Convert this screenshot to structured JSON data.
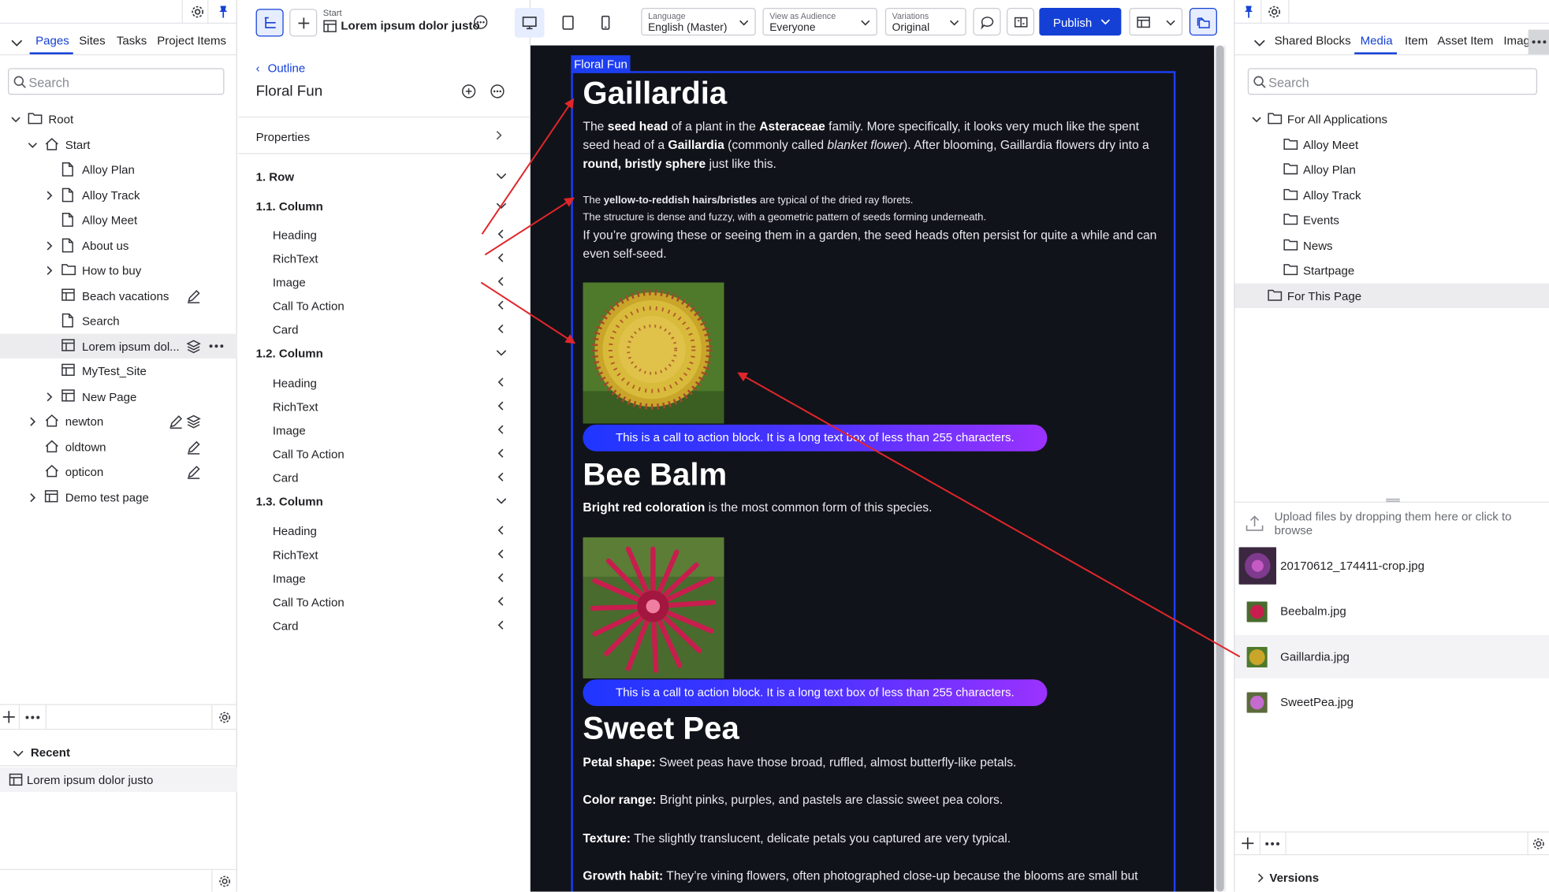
{
  "left_panel": {
    "tabs": [
      "Pages",
      "Sites",
      "Tasks",
      "Project Items"
    ],
    "search_placeholder": "Search",
    "tree": [
      {
        "label": "Root",
        "level": 0,
        "expand": "open",
        "icon": "folder"
      },
      {
        "label": "Start",
        "level": 1,
        "expand": "open",
        "icon": "home"
      },
      {
        "label": "Alloy Plan",
        "level": 2,
        "expand": "none",
        "icon": "page"
      },
      {
        "label": "Alloy Track",
        "level": 2,
        "expand": "closed",
        "icon": "page"
      },
      {
        "label": "Alloy Meet",
        "level": 2,
        "expand": "none",
        "icon": "page"
      },
      {
        "label": "About us",
        "level": 2,
        "expand": "closed",
        "icon": "page"
      },
      {
        "label": "How to buy",
        "level": 2,
        "expand": "closed",
        "icon": "folder"
      },
      {
        "label": "Beach vacations",
        "level": 2,
        "expand": "none",
        "icon": "layout",
        "action": "edit"
      },
      {
        "label": "Search",
        "level": 2,
        "expand": "none",
        "icon": "page"
      },
      {
        "label": "Lorem ipsum dol...",
        "level": 2,
        "expand": "none",
        "icon": "layout",
        "action": "layers-more",
        "selected": true
      },
      {
        "label": "MyTest_Site",
        "level": 2,
        "expand": "none",
        "icon": "layout"
      },
      {
        "label": "New Page",
        "level": 2,
        "expand": "closed",
        "icon": "layout"
      },
      {
        "label": "newton",
        "level": 1,
        "expand": "closed",
        "icon": "home",
        "action": "edit-layers"
      },
      {
        "label": "oldtown",
        "level": 1,
        "expand": "none",
        "icon": "home",
        "action": "edit"
      },
      {
        "label": "opticon",
        "level": 1,
        "expand": "none",
        "icon": "home",
        "action": "edit"
      },
      {
        "label": "Demo test page",
        "level": 1,
        "expand": "closed",
        "icon": "layout"
      }
    ],
    "recent_title": "Recent",
    "recent_item": "Lorem ipsum dolor justo"
  },
  "outline_panel": {
    "breadcrumb_label": "Start",
    "page_name": "Lorem ipsum dolor justo",
    "back_label": "Outline",
    "title": "Floral Fun",
    "properties_label": "Properties",
    "rows": [
      {
        "label": "1. Row",
        "group": true
      },
      {
        "label": "1.1. Column",
        "group": true
      },
      {
        "label": "Heading"
      },
      {
        "label": "RichText"
      },
      {
        "label": "Image"
      },
      {
        "label": "Call To Action"
      },
      {
        "label": "Card"
      },
      {
        "label": "1.2. Column",
        "group": true
      },
      {
        "label": "Heading"
      },
      {
        "label": "RichText"
      },
      {
        "label": "Image"
      },
      {
        "label": "Call To Action"
      },
      {
        "label": "Card"
      },
      {
        "label": "1.3. Column",
        "group": true
      },
      {
        "label": "Heading"
      },
      {
        "label": "RichText"
      },
      {
        "label": "Image"
      },
      {
        "label": "Call To Action"
      },
      {
        "label": "Card"
      }
    ]
  },
  "toolbar": {
    "language": {
      "caption": "Language",
      "value": "English (Master)"
    },
    "audience": {
      "caption": "View as Audience",
      "value": "Everyone"
    },
    "variations": {
      "caption": "Variations",
      "value": "Original"
    },
    "publish_label": "Publish"
  },
  "preview": {
    "frame_label": "Floral Fun",
    "gaillardia": {
      "heading": "Gaillardia",
      "p1_a": "The ",
      "p1_b": "seed head",
      "p1_c": " of a plant in the ",
      "p1_d": "Asteraceae",
      "p1_e": " family. More specifically, it looks very much like the spent seed head of a ",
      "p1_f": "Gaillardia",
      "p1_g": " (commonly called ",
      "p1_h": "blanket flower",
      "p1_i": "). After blooming, Gaillardia flowers dry into a ",
      "p1_j": "round, bristly sphere",
      "p1_k": " just like this.",
      "s1_a": "The ",
      "s1_b": "yellow-to-reddish hairs/bristles",
      "s1_c": " are typical of the dried ray florets.",
      "s2": "The structure is dense and fuzzy, with a geometric pattern of seeds forming underneath.",
      "p2": "If you’re growing these or seeing them in a garden, the seed heads often persist for quite a while and can even self-seed.",
      "cta": "This is a call to action block. It is a long text box of less than 255 characters."
    },
    "beebalm": {
      "heading": "Bee Balm",
      "p_b": "Bright red coloration",
      "p_rest": " is the most common form of this species.",
      "cta": "This is a call to action block. It is a long text box of less than 255 characters."
    },
    "sweetpea": {
      "heading": "Sweet Pea",
      "l1_b": "Petal shape:",
      "l1": " Sweet peas have those broad, ruffled, almost butterfly-like petals.",
      "l2_b": "Color range:",
      "l2": " Bright pinks, purples, and pastels are classic sweet pea colors.",
      "l3_b": "Texture:",
      "l3": " The slightly translucent, delicate petals you captured are very typical.",
      "l4_b": "Growth habit:",
      "l4": " They’re vining flowers, often photographed close-up because the blooms are small but"
    }
  },
  "right_panel": {
    "tabs": [
      "Shared Blocks",
      "Media",
      "Item",
      "Asset Item",
      "Imag"
    ],
    "search_placeholder": "Search",
    "tree": [
      {
        "label": "For All Applications",
        "level": 0,
        "expand": "open"
      },
      {
        "label": "Alloy Meet",
        "level": 1
      },
      {
        "label": "Alloy Plan",
        "level": 1
      },
      {
        "label": "Alloy Track",
        "level": 1
      },
      {
        "label": "Events",
        "level": 1
      },
      {
        "label": "News",
        "level": 1
      },
      {
        "label": "Startpage",
        "level": 1
      },
      {
        "label": "For This Page",
        "level": 0,
        "selected": true
      }
    ],
    "upload_text": "Upload files by dropping them here or click to browse",
    "media": [
      "20170612_174411-crop.jpg",
      "Beebalm.jpg",
      "Gaillardia.jpg",
      "SweetPea.jpg"
    ],
    "versions_label": "Versions"
  },
  "colors": {
    "accent": "#1440d6",
    "frame": "#1d3df0",
    "preview_bg": "#11131a",
    "arrow": "#e0262a"
  }
}
